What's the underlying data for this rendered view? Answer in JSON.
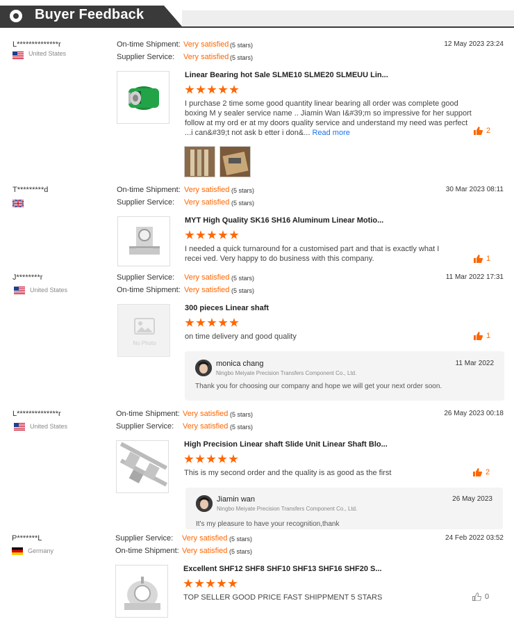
{
  "header": {
    "title": "Buyer Feedback"
  },
  "labels": {
    "ontime": "On-time Shipment:",
    "service": "Supplier Service:",
    "very_satisfied": "Very satisfied",
    "five_stars": "(5 stars)",
    "read_more": "Read more",
    "no_photo": "No Photo"
  },
  "reviews": [
    {
      "name": "L**************r",
      "country": "United States",
      "date": "12 May 2023 23:24",
      "product": "Linear Bearing hot Sale SLME10 SLME20 SLMEUU Lin...",
      "text": "I purchase 2 time some good quantity linear bearing all order was complete good boxing M y sealer service name .. Jiamin Wan I&#39;m so impressive for her support follow at my ord er at my doors quality service and understand my need was perfect ...i can&#39;t not ask b etter i don&...",
      "likes": "2"
    },
    {
      "name": "T*********d",
      "country": "",
      "date": "30 Mar 2023 08:11",
      "product": "MYT High Quality SK16 SH16 Aluminum Linear Motio...",
      "text": "I needed a quick turnaround for a customised part and that is exactly what I recei ved.  Very happy to do business with this company.",
      "likes": "1"
    },
    {
      "name": "J********r",
      "country": "United States",
      "date": "11 Mar 2022 17:31",
      "product": "300 pieces Linear shaft",
      "text": "on time delivery and good quality",
      "likes": "1",
      "reply": {
        "name": "monica chang",
        "company": "Ningbo Meiyate Precision Transfers Component Co., Ltd.",
        "date": "11 Mar 2022",
        "text": "Thank you for choosing our company and hope we will get your next order soon."
      }
    },
    {
      "name": "L**************r",
      "country": "United States",
      "date": "26 May 2023 00:18",
      "product": "High Precision Linear shaft Slide Unit Linear Shaft Blo...",
      "text": "This is my second order and the quality is as good as the first",
      "likes": "2",
      "reply": {
        "name": "Jiamin wan",
        "company": "Ningbo Meiyate Precision Transfers Component Co., Ltd.",
        "date": "26 May 2023",
        "text": "It's my pleasure to have your recognition,thank"
      }
    },
    {
      "name": "P*******L",
      "country": "Germany",
      "date": "24 Feb 2022 03:52",
      "product": "Excellent SHF12 SHF8 SHF10 SHF13 SHF16 SHF20 S...",
      "text": "TOP SELLER GOOD PRICE FAST SHIPPMENT 5 STARS",
      "likes": "0"
    }
  ],
  "colors": {
    "accent": "#ff6600",
    "header": "#3a3a3a",
    "link": "#1a73e8"
  }
}
